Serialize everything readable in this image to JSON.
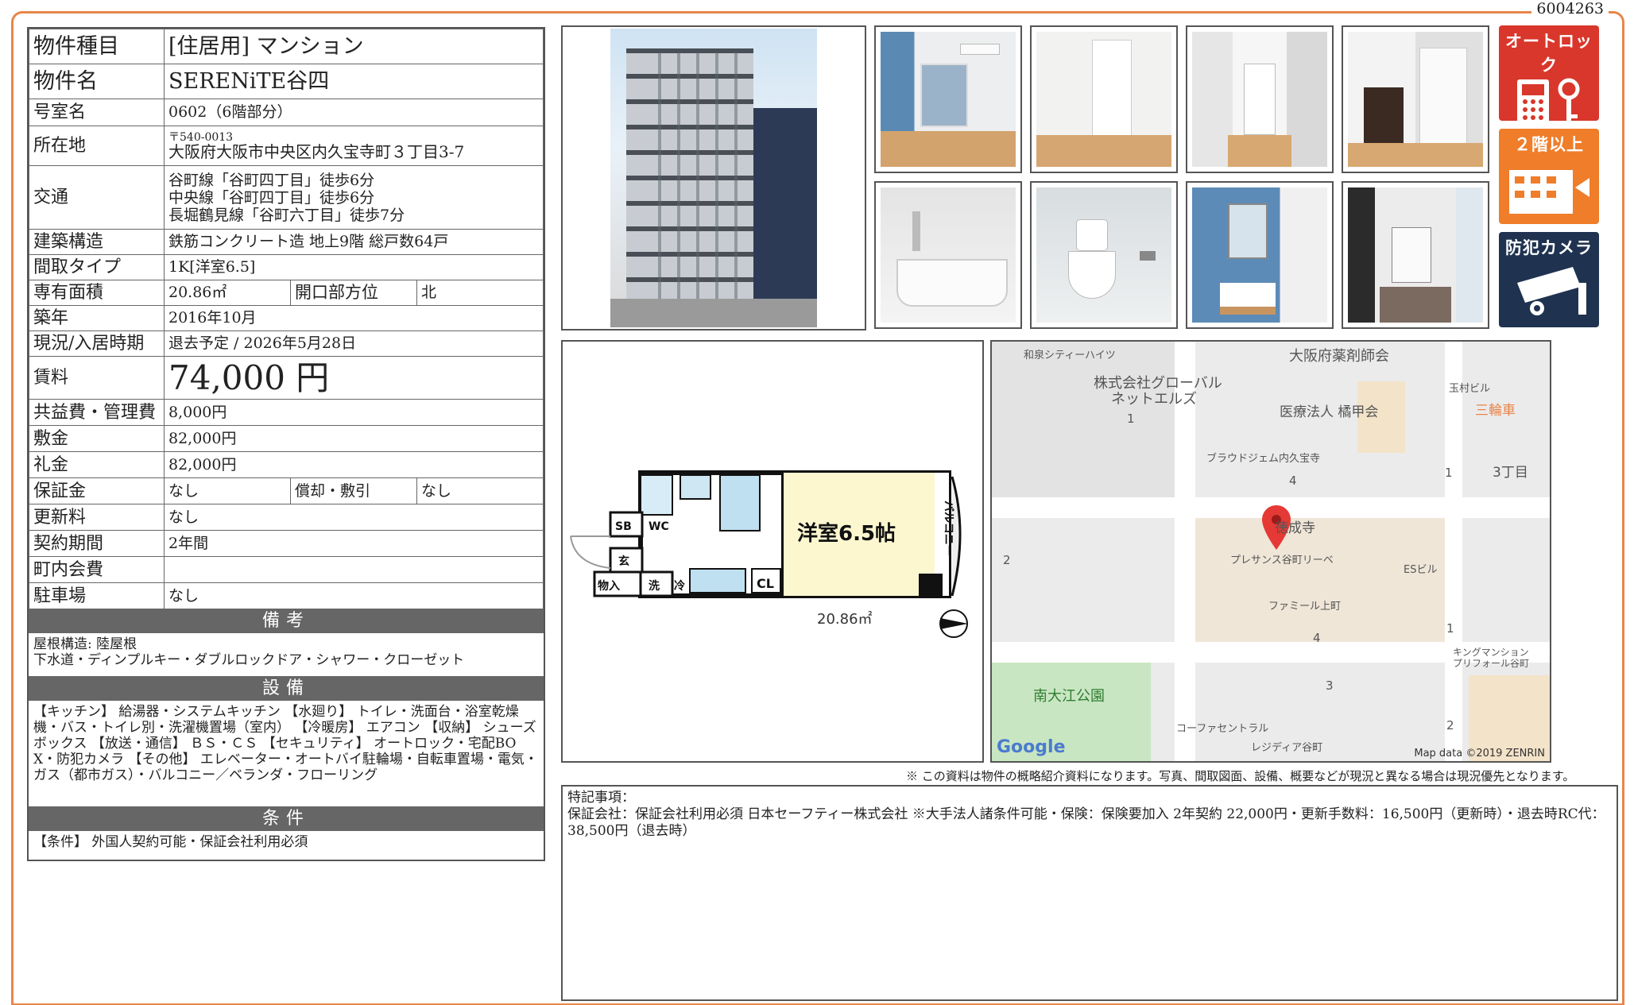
{
  "doc_id": "6004263",
  "property": {
    "type_label": "物件種目",
    "type_value": "[住居用]  マンション",
    "name_label": "物件名",
    "name_value": "SERENiTE谷四",
    "room_label": "号室名",
    "room_value": "0602（6階部分）",
    "address_label": "所在地",
    "postal": "〒540-0013",
    "address_value": "大阪府大阪市中央区内久宝寺町３丁目3-7",
    "transit_label": "交通",
    "transit": [
      "谷町線「谷町四丁目」徒歩6分",
      "中央線「谷町四丁目」徒歩6分",
      "長堀鶴見線「谷町六丁目」徒歩7分"
    ],
    "structure_label": "建築構造",
    "structure_value": "鉄筋コンクリート造 地上9階 総戸数64戸",
    "layout_label": "間取タイプ",
    "layout_value": "1K[洋室6.5]",
    "area_label": "専有面積",
    "area_value": "20.86㎡",
    "direction_label": "開口部方位",
    "direction_value": "北",
    "built_label": "築年",
    "built_value": "2016年10月",
    "status_label": "現況/入居時期",
    "status_value": "退去予定 /  2026年5月28日",
    "rent_label": "賃料",
    "rent_value": "74,000 円",
    "fee_label": "共益費・管理費",
    "fee_value": "8,000円",
    "deposit_label": "敷金",
    "deposit_value": "82,000円",
    "key_money_label": "礼金",
    "key_money_value": "82,000円",
    "guarantee_label": "保証金",
    "guarantee_value": "なし",
    "amortization_label": "償却・敷引",
    "amortization_value": "なし",
    "renewal_label": "更新料",
    "renewal_value": "なし",
    "contract_label": "契約期間",
    "contract_value": "2年間",
    "community_label": "町内会費",
    "community_value": "",
    "parking_label": "駐車場",
    "parking_value": "なし"
  },
  "remarks": {
    "title": "備考",
    "lines": [
      "屋根構造:  陸屋根",
      "下水道・ディンプルキー・ダブルロックドア・シャワー・クローゼット"
    ]
  },
  "equipment": {
    "title": "設備",
    "text": "【キッチン】 給湯器・システムキッチン 【水廻り】 トイレ・洗面台・浴室乾燥機・バス・トイレ別・洗濯機置場（室内） 【冷暖房】 エアコン 【収納】 シューズボックス 【放送・通信】 ＢＳ・ＣＳ 【セキュリティ】 オートロック・宅配BOX・防犯カメラ 【その他】 エレベーター・オートバイ駐輪場・自転車置場・電気・ガス（都市ガス）・バルコニー／ベランダ・フローリング"
  },
  "conditions": {
    "title": "条件",
    "text": "【条件】 外国人契約可能・保証会社利用必須"
  },
  "badges": {
    "autolock": "オートロック",
    "second_floor": "２階以上",
    "camera": "防犯カメラ"
  },
  "floorplan": {
    "room_label": "洋室6.5帖",
    "balcony": "バルコニー",
    "area": "20.86㎡",
    "sb": "SB",
    "wc": "WC",
    "entrance": "玄",
    "storage": "物入",
    "wash": "洗",
    "fridge": "冷",
    "closet": "CL"
  },
  "map": {
    "labels": [
      "和泉シティーハイツ",
      "大阪府薬剤師会",
      "株式会社グローバル",
      "ネットエルズ",
      "医療法人 橘甲会",
      "玉村ビル",
      "三輪車",
      "ブラウドジェム内久宝寺",
      "3丁目",
      "徳成寺",
      "プレサンス谷町リーベ",
      "ESビル",
      "ファミール上町",
      "キングマンション",
      "プリフォール谷町",
      "南大江公園",
      "コーファセントラル",
      "レジディア谷町"
    ],
    "numbers": [
      "1",
      "4",
      "1",
      "2",
      "4",
      "1",
      "3",
      "2"
    ],
    "google": "Google",
    "credit": "Map data ©2019 ZENRIN"
  },
  "caution": "※ この資料は物件の概略紹介資料になります。写真、間取図面、設備、概要などが現況と異なる場合は現況優先となります。",
  "notes": {
    "title": "特記事項：",
    "text": "保証会社：保証会社利用必須 日本セーフティー株式会社  ※大手法人諸条件可能・保険：保険要加入 2年契約 22,000円・更新手数料：16,500円（更新時）・退去時RC代：38,500円（退去時）"
  },
  "colors": {
    "frame": "#e8864a",
    "badge_red": "#d9372b",
    "badge_orange": "#ef7d2a",
    "badge_navy": "#1f3350",
    "section": "#666666"
  }
}
